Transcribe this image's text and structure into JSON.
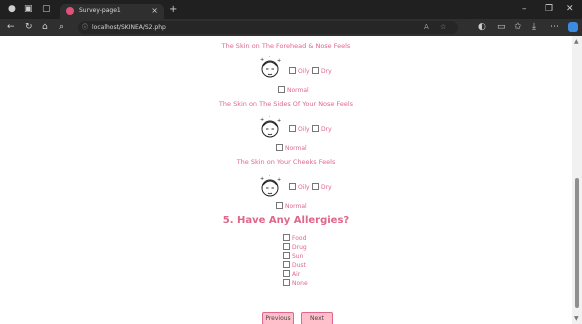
{
  "browser": {
    "tab_title": "Survey-page1",
    "url": "localhost/SKINEA/S2.php",
    "controls": {
      "minimize": "–",
      "restore": "❐",
      "close": "✕",
      "new_tab": "+",
      "tab_close": "×"
    }
  },
  "survey": {
    "zones": [
      {
        "label": "The Skin on The Forehead & Nose Feels",
        "options": [
          "Oily",
          "Dry",
          "Normal"
        ]
      },
      {
        "label": "The Skin on The Sides Of Your Nose Feels",
        "options": [
          "Oily",
          "Dry",
          "Normal"
        ]
      },
      {
        "label": "The Skin on Your Cheeks Feels",
        "options": [
          "Oily",
          "Dry",
          "Normal"
        ]
      }
    ],
    "allergies": {
      "heading": "5. Have Any Allergies?",
      "options": [
        "Food",
        "Drug",
        "Sun",
        "Dust",
        "Air",
        "None"
      ]
    },
    "buttons": {
      "previous": "Previous",
      "next": "Next"
    }
  },
  "colors": {
    "accent": "#e0668a",
    "button_bg": "#ffc0cb",
    "chrome": "#2b2b2b"
  }
}
